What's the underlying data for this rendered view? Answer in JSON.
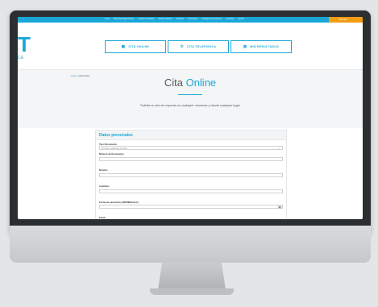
{
  "topbar": {
    "nav": [
      "Inicio",
      "Pruebas Diagnósticas",
      "Unidad IT Médica",
      "Equipo Médico",
      "Noticias",
      "Formación",
      "Trabaja con Nosotros",
      "Contacto",
      "Ayuda"
    ],
    "cta": "Pedir cita"
  },
  "brand": {
    "logo": "T",
    "sub": "CE"
  },
  "header": {
    "btn_online": "CITA ONLINE",
    "btn_phone": "CITA TELEFÓNICA",
    "btn_results": "MIS RESULTADOS"
  },
  "breadcrumb": {
    "home": "Inicio",
    "sep": "»",
    "current": "Cita Online"
  },
  "hero": {
    "title_plain": "Cita ",
    "title_highlight": "Online",
    "subtitle": "Solicita su cita sin esperas en cualquier momento y desde cualquier lugar"
  },
  "form": {
    "section_title": "Datos personales",
    "tipo_doc_label": "Tipo Documento",
    "tipo_doc_value": "Por favor, seleccione un valor",
    "num_doc_label": "Número de Documento",
    "nombre_label": "Nombre",
    "apellidos_label": "Apellidos",
    "fecha_label": "Fecha de nacimiento (DD/MM/AAAA)",
    "email_label": "Email"
  },
  "colors": {
    "accent": "#1aa7d8",
    "cta": "#f39c12"
  }
}
